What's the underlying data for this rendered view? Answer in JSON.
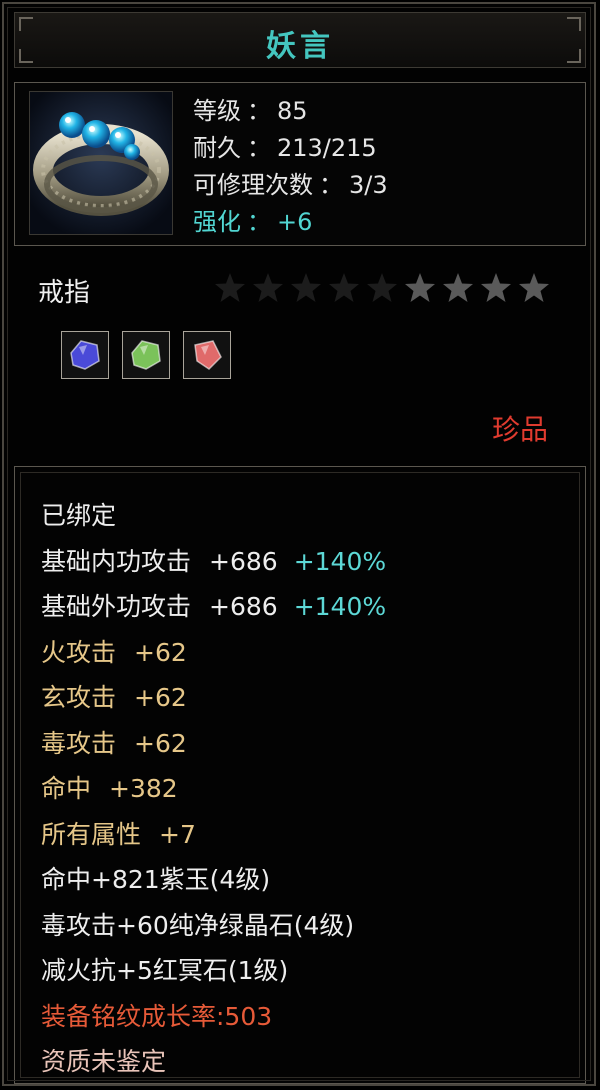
{
  "title": "妖言",
  "header": {
    "item_icon": "ring-icon",
    "level_label": "等级",
    "level_value": "85",
    "durability_label": "耐久",
    "durability_value": "213/215",
    "repair_label": "可修理次数",
    "repair_value": "3/3",
    "enhance_label": "强化",
    "enhance_value": "+6",
    "colon": "："
  },
  "item_type": "戒指",
  "stars": {
    "filled": 4,
    "total": 9,
    "filled_color": "#5a5a5a",
    "empty_color": "#1c1c1c"
  },
  "gems": [
    {
      "name": "purple-gem-icon",
      "color": "#4a4ad8"
    },
    {
      "name": "green-gem-icon",
      "color": "#7bc25a"
    },
    {
      "name": "red-gem-icon",
      "color": "#e06a6a"
    }
  ],
  "rarity": "珍品",
  "attributes": [
    {
      "text": "已绑定",
      "color": "white"
    },
    {
      "text": "基础内功攻击",
      "value": "+686",
      "pct": "+140%",
      "color": "white"
    },
    {
      "text": "基础外功攻击",
      "value": "+686",
      "pct": "+140%",
      "color": "white"
    },
    {
      "text": "火攻击",
      "value": "+62",
      "color": "gold"
    },
    {
      "text": "玄攻击",
      "value": "+62",
      "color": "gold"
    },
    {
      "text": "毒攻击",
      "value": "+62",
      "color": "gold"
    },
    {
      "text": "命中",
      "value": "+382",
      "color": "gold"
    },
    {
      "text": "所有属性",
      "value": "+7",
      "color": "gold"
    },
    {
      "text": "命中+821紫玉(4级)",
      "color": "white"
    },
    {
      "text": "毒攻击+60纯净绿晶石(4级)",
      "color": "white"
    },
    {
      "text": "减火抗+5红冥石(1级)",
      "color": "white"
    },
    {
      "text": "装备铭纹成长率:503",
      "color": "orange"
    },
    {
      "text": "资质未鉴定",
      "color": "pink"
    }
  ],
  "colors": {
    "title_cyan": "#44c6bf",
    "enhance_cyan": "#52d6d2",
    "rarity_red": "#e03b2f"
  }
}
